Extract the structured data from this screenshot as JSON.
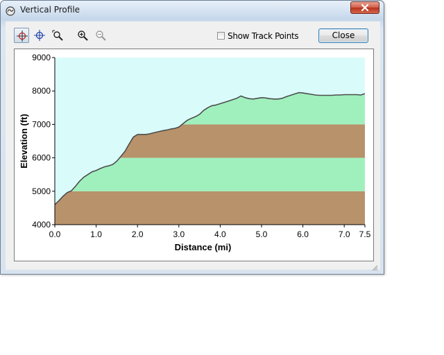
{
  "window": {
    "title": "Vertical Profile",
    "show_track_points_label": "Show Track Points",
    "show_track_points_checked": false,
    "close_label": "Close"
  },
  "toolbar": {
    "tools": [
      "select-point-icon",
      "crosshair-icon",
      "zoom-box-icon",
      "zoom-in-icon",
      "zoom-out-icon"
    ],
    "active_tool": "select-point-icon"
  },
  "colors": {
    "sky": "#d9fcfb",
    "band_light": "#9ff0bd",
    "band_dark": "#b7926a",
    "profile_line": "#4d4d4d"
  },
  "chart_data": {
    "type": "area",
    "xlabel": "Distance   (mi)",
    "ylabel": "Elevation  (ft)",
    "xlim": [
      0.0,
      7.5
    ],
    "ylim": [
      4000,
      9000
    ],
    "x_ticks": [
      "0.0",
      "1.0",
      "2.0",
      "3.0",
      "4.0",
      "5.0",
      "6.0",
      "7.0",
      "7.5"
    ],
    "x_tick_values": [
      0,
      1,
      2,
      3,
      4,
      5,
      6,
      7,
      7.5
    ],
    "y_ticks": [
      "4000",
      "5000",
      "6000",
      "7000",
      "8000",
      "9000"
    ],
    "y_tick_values": [
      4000,
      5000,
      6000,
      7000,
      8000,
      9000
    ],
    "bands": [
      {
        "from": 4000,
        "to": 5000,
        "color": "#b7926a"
      },
      {
        "from": 5000,
        "to": 6000,
        "color": "#9ff0bd"
      },
      {
        "from": 6000,
        "to": 7000,
        "color": "#b7926a"
      },
      {
        "from": 7000,
        "to": 9000,
        "color": "#9ff0bd"
      }
    ],
    "x": [
      0.0,
      0.1,
      0.2,
      0.3,
      0.4,
      0.5,
      0.6,
      0.7,
      0.8,
      0.9,
      1.0,
      1.1,
      1.2,
      1.3,
      1.4,
      1.5,
      1.6,
      1.7,
      1.8,
      1.9,
      2.0,
      2.1,
      2.2,
      2.3,
      2.4,
      2.5,
      2.6,
      2.7,
      2.8,
      2.9,
      3.0,
      3.1,
      3.2,
      3.3,
      3.4,
      3.5,
      3.6,
      3.7,
      3.8,
      3.9,
      4.0,
      4.1,
      4.2,
      4.3,
      4.4,
      4.5,
      4.6,
      4.7,
      4.8,
      4.9,
      5.0,
      5.1,
      5.2,
      5.3,
      5.4,
      5.5,
      5.6,
      5.7,
      5.8,
      5.9,
      6.0,
      6.1,
      6.2,
      6.3,
      6.4,
      6.5,
      6.6,
      6.7,
      6.8,
      6.9,
      7.0,
      7.1,
      7.2,
      7.3,
      7.4,
      7.5
    ],
    "elevation": [
      4600,
      4720,
      4850,
      4960,
      5010,
      5150,
      5300,
      5420,
      5500,
      5580,
      5620,
      5680,
      5730,
      5760,
      5800,
      5900,
      6050,
      6200,
      6420,
      6620,
      6700,
      6700,
      6700,
      6720,
      6750,
      6780,
      6810,
      6830,
      6860,
      6880,
      6920,
      7020,
      7120,
      7180,
      7230,
      7300,
      7420,
      7500,
      7560,
      7580,
      7620,
      7660,
      7700,
      7740,
      7780,
      7850,
      7800,
      7770,
      7760,
      7780,
      7800,
      7790,
      7770,
      7760,
      7760,
      7780,
      7830,
      7870,
      7910,
      7950,
      7940,
      7920,
      7900,
      7880,
      7870,
      7870,
      7870,
      7870,
      7880,
      7880,
      7890,
      7890,
      7890,
      7890,
      7880,
      7920
    ]
  }
}
